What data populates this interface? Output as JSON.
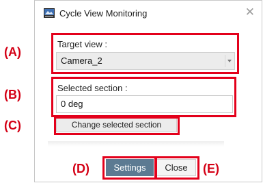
{
  "window": {
    "title": "Cycle View Monitoring",
    "icon": "app-monitor-icon",
    "close_glyph": "✕"
  },
  "target_view": {
    "label": "Target view :",
    "selected_value": "Camera_2"
  },
  "selected_section": {
    "label": "Selected section :",
    "value": "0 deg"
  },
  "change_section_button": {
    "label": "Change selected section"
  },
  "footer": {
    "settings_label": "Settings",
    "close_label": "Close"
  },
  "callouts": {
    "a": "(A)",
    "b": "(B)",
    "c": "(C)",
    "d": "(D)",
    "e": "(E)"
  },
  "colors": {
    "annotation": "#e3001b",
    "primary_button": "#5c7a92"
  }
}
